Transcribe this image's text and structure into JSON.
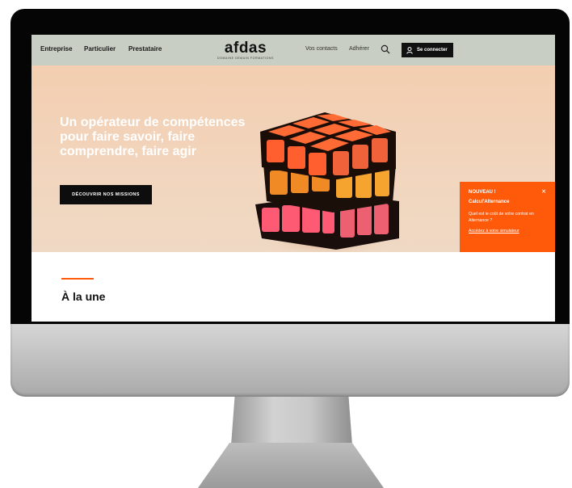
{
  "nav": {
    "links_left": [
      "Entreprise",
      "Particulier",
      "Prestataire"
    ],
    "logo_text": "afdas",
    "logo_tagline": "DOMAINE DEMAIN FORMATIONS",
    "links_right": [
      "Vos contacts",
      "Adhérer"
    ],
    "login_label": "Se connecter"
  },
  "hero": {
    "title": "Un opérateur de compétences pour faire savoir, faire comprendre, faire agir",
    "cta_label": "DÉCOUVRIR NOS MISSIONS"
  },
  "promo": {
    "badge": "NOUVEAU !",
    "title": "Calcul'Alternance",
    "text": "Quel est le coût de votre contrat en Alternance ?",
    "link": "Accédez à votre simulateur",
    "close_symbol": "×"
  },
  "section": {
    "title": "À la une"
  },
  "colors": {
    "accent": "#ff5a0a",
    "nav_bg": "#c9cec4",
    "hero_bg": "#f3ceb0"
  },
  "icons": [
    "search-icon",
    "user-icon",
    "close-icon"
  ]
}
